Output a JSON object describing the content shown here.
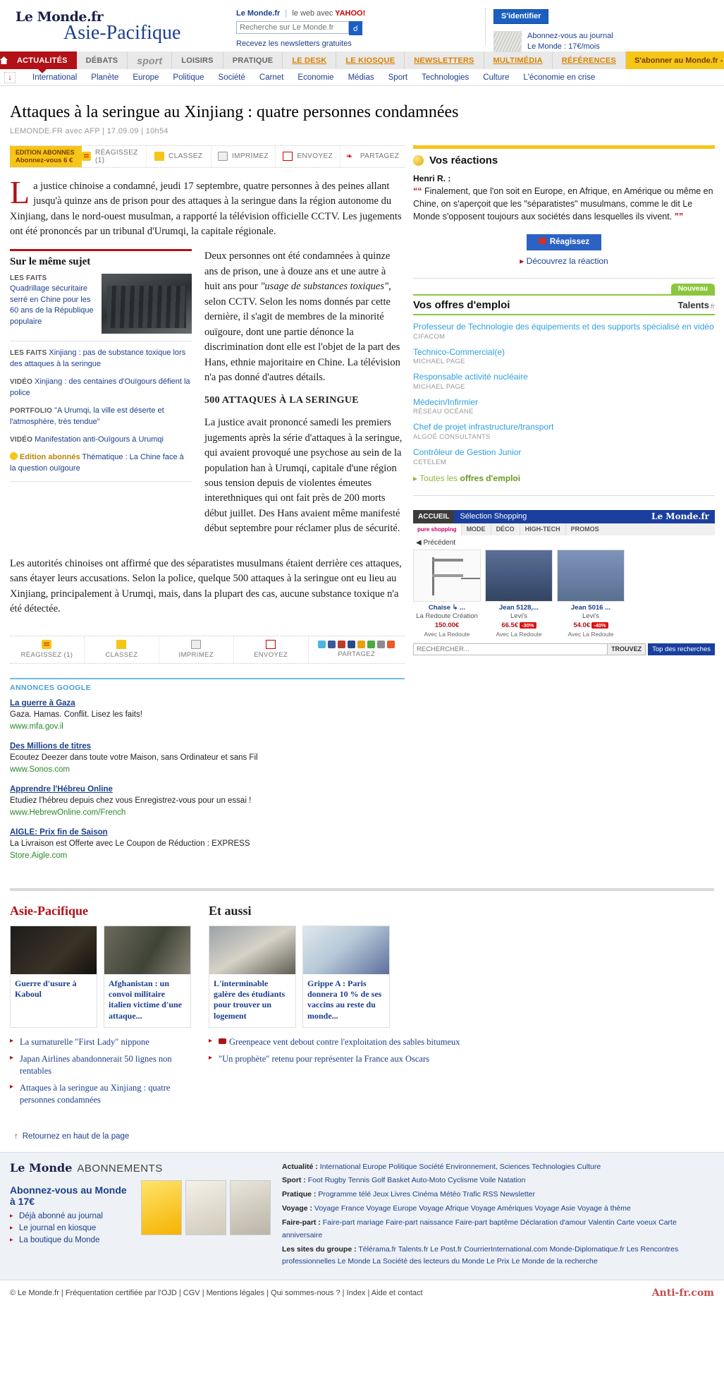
{
  "header": {
    "logo": "Le Monde.fr",
    "section_title": "Asie-Pacifique",
    "brand_label": "Le Monde.fr",
    "web_label": "le web avec",
    "yahoo": "YAHOO!",
    "search_placeholder": "Recherche sur Le Monde.fr",
    "search_icon": "search-icon",
    "newsletters": "Recevez les newsletters gratuites",
    "signin": "S'identifier",
    "subscribe_line1": "Abonnez-vous au journal",
    "subscribe_line2": "Le Monde : 17€/mois"
  },
  "mainnav": {
    "home_icon": "home-icon",
    "items": [
      {
        "label": "ACTUALITÉS",
        "style": "active"
      },
      {
        "label": "DÉBATS",
        "style": "grey"
      },
      {
        "label": "sport",
        "style": "sportlogo"
      },
      {
        "label": "LOISIRS",
        "style": "grey"
      },
      {
        "label": "PRATIQUE",
        "style": "grey"
      },
      {
        "label": "LE DESK",
        "style": "orange"
      },
      {
        "label": "LE KIOSQUE",
        "style": "orange"
      },
      {
        "label": "NEWSLETTERS",
        "style": "orange"
      },
      {
        "label": "MULTIMÉDIA",
        "style": "orange"
      },
      {
        "label": "RÉFÉRENCES",
        "style": "orange"
      }
    ],
    "promo": "S'abonner au Monde.fr - 6€ / mois"
  },
  "subnav": {
    "anchor_icon": "down-arrow-icon",
    "items": [
      "International",
      "Planète",
      "Europe",
      "Politique",
      "Société",
      "Carnet",
      "Economie",
      "Médias",
      "Sport",
      "Technologies",
      "Culture",
      "L'économie en crise"
    ]
  },
  "article": {
    "title": "Attaques à la seringue au Xinjiang : quatre personnes condamnées",
    "byline": "LEMONDE.FR avec AFP | 17.09.09 | 10h54",
    "dropcap": "L",
    "chapo": "a justice chinoise a condamné, jeudi 17 septembre, quatre personnes à des peines allant jusqu'à quinze ans de prison pour des attaques à la seringue dans la région autonome du Xinjiang, dans le nord-ouest musulman, a rapporté la télévision officielle CCTV. Les jugements ont été prononcés par un tribunal d'Urumqi, la capitale régionale.",
    "para2_a": "Deux personnes ont été condamnées à quinze ans de prison, une à douze ans et une autre à huit ans pour ",
    "para2_italic": "\"usage de substances toxiques\"",
    "para2_b": ", selon CCTV. Selon les noms donnés par cette dernière, il s'agit de membres de la minorité ouïgoure, dont une partie dénonce la discrimination dont elle est l'objet de la part des Hans, ethnie majoritaire en Chine. La télévision n'a pas donné d'autres détails.",
    "subtitle": "500 ATTAQUES À LA SERINGUE",
    "para3": "La justice avait prononcé samedi les premiers jugements après la série d'attaques à la seringue, qui avaient provoqué une psychose au sein de la population han à Urumqi, capitale d'une région sous tension depuis de violentes émeutes interethniques qui ont fait près de 200 morts début juillet. Des Hans avaient même manifesté début septembre pour réclamer plus de sécurité.",
    "para4": "Les autorités chinoises ont affirmé que des séparatistes musulmans étaient derrière ces attaques, sans étayer leurs accusations. Selon la police, quelque 500 attaques à la seringue ont eu lieu au Xinjiang, principalement à Urumqi, mais, dans la plupart des cas, aucune substance toxique n'a été détectée."
  },
  "toolbar": {
    "abo_line1": "EDITION ABONNES",
    "abo_line2": "Abonnez-vous 6 €",
    "items": [
      {
        "label": "RÉAGISSEZ (1)",
        "icon": "comment-icon"
      },
      {
        "label": "CLASSEZ",
        "icon": "bookmark-icon"
      },
      {
        "label": "IMPRIMEZ",
        "icon": "printer-icon"
      },
      {
        "label": "ENVOYEZ",
        "icon": "envelope-icon"
      },
      {
        "label": "PARTAGEZ",
        "icon": "share-icon"
      }
    ]
  },
  "sharebar": {
    "items": [
      {
        "label": "RÉAGISSEZ (1)",
        "icon": "comment-icon"
      },
      {
        "label": "CLASSEZ",
        "icon": "bookmark-icon"
      },
      {
        "label": "IMPRIMEZ",
        "icon": "printer-icon"
      },
      {
        "label": "ENVOYEZ",
        "icon": "envelope-icon"
      },
      {
        "label": "PARTAGEZ",
        "icon": "share-icon"
      }
    ],
    "share_icons": [
      "twitter-icon",
      "facebook-icon",
      "wikio-icon",
      "delicious-icon",
      "scoopeo-icon",
      "google-icon",
      "netvibes-icon",
      "more-icon"
    ]
  },
  "same_subject": {
    "heading": "Sur le même sujet",
    "featured": {
      "label": "LES FAITS",
      "link": "Quadrillage sécuritaire serré en Chine pour les 60 ans de la République populaire",
      "thumb": "riot-police-photo"
    },
    "items": [
      {
        "label": "LES FAITS",
        "link": "Xinjiang : pas de substance toxique lors des attaques à la seringue"
      },
      {
        "label": "VIDÉO",
        "link": "Xinjiang : des centaines d'Ouïgours défient la police"
      },
      {
        "label": "PORTFOLIO",
        "link": "\"A Urumqi, la ville est déserte et l'atmosphère, très tendue\""
      },
      {
        "label": "VIDÉO",
        "link": "Manifestation anti-Ouïgours à Urumqi"
      },
      {
        "label": "Edition abonnés",
        "link": "Thématique : La Chine face à la question ouïgoure",
        "badge": true
      }
    ]
  },
  "reactions": {
    "heading": "Vos réactions",
    "icon": "smiley-icon",
    "author": "Henri R. :",
    "quote": "Finalement, que l'on soit en Europe, en Afrique, en Amérique ou même en Chine, on s'aperçoit que les \"séparatistes\" musulmans, comme le dit Le Monde s'opposent toujours aux sociétés dans lesquelles ils vivent.",
    "button": "Réagissez",
    "discover": "Découvrez la réaction"
  },
  "jobs": {
    "badge": "Nouveau",
    "heading": "Vos offres d'emploi",
    "logo": "Talents",
    "logo_tld": ".fr",
    "items": [
      {
        "title": "Professeur de Technologie des équipements et des supports spécialisé en vidéo",
        "company": "CIFACOM"
      },
      {
        "title": "Technico-Commercial(e)",
        "company": "MICHAEL PAGE"
      },
      {
        "title": "Responsable activité nucléaire",
        "company": "MICHAEL PAGE"
      },
      {
        "title": "Médecin/Infirmier",
        "company": "RÉSEAU OCÉANE"
      },
      {
        "title": "Chef de projet infrastructure/transport",
        "company": "ALGOÉ CONSULTANTS"
      },
      {
        "title": "Contrôleur de Gestion Junior",
        "company": "CETELEM"
      }
    ],
    "all_prefix": "Toutes les ",
    "all_bold": "offres d'emploi"
  },
  "shopping": {
    "accueil": "ACCUEIL",
    "title": "Sélection Shopping",
    "brand": "Le Monde.fr",
    "pure_tag": "pure shopping",
    "tabs": [
      "MODE",
      "DÉCO",
      "HIGH-TECH",
      "PROMOS"
    ],
    "prev": "Précédent",
    "products": [
      {
        "name": "Chaise ↳ ...",
        "sub": "La Redoute Création",
        "price": "150.00€",
        "old": "",
        "promo": "",
        "retailer": "Avec La Redoute",
        "img": "chair"
      },
      {
        "name": "Jean 5128,...",
        "sub": "Levi's",
        "price": "66.5€",
        "old": "",
        "promo": "-30%",
        "retailer": "Avec La Redoute",
        "img": "jeans1"
      },
      {
        "name": "Jean 5016 ...",
        "sub": "Levi's",
        "price": "54.0€",
        "old": "",
        "promo": "-40%",
        "retailer": "Avec La Redoute",
        "img": "jeans2"
      }
    ],
    "search_placeholder": "RECHERCHER...",
    "search_button": "TROUVEZ",
    "top_searches": "Top des recherches"
  },
  "ads": {
    "heading": "ANNONCES GOOGLE",
    "items": [
      {
        "title": "La guerre à Gaza",
        "desc": "Gaza. Hamas. Conflit. Lisez les faits!",
        "url": "www.mfa.gov.il"
      },
      {
        "title": "Des Millions de titres",
        "desc": "Ecoutez Deezer dans toute votre Maison, sans Ordinateur et sans Fil",
        "url": "www.Sonos.com"
      },
      {
        "title": "Apprendre l'Hébreu Online",
        "desc": "Etudiez l'hébreu depuis chez vous Enregistrez-vous pour un essai !",
        "url": "www.HebrewOnline.com/French"
      },
      {
        "title": "AIGLE: Prix fin de Saison",
        "desc": "La Livraison est Offerte avec Le Coupon de Réduction : EXPRESS",
        "url": "Store.Aigle.com"
      }
    ]
  },
  "bottom": {
    "left_title": "Asie-Pacifique",
    "right_title": "Et aussi",
    "left_cards": [
      {
        "caption": "Guerre d'usure à Kaboul",
        "img": "karzai-photo"
      },
      {
        "caption": "Afghanistan : un convoi militaire italien victime d'une attaque...",
        "img": "convoy-photo"
      }
    ],
    "right_cards": [
      {
        "caption": "L'interminable galère des étudiants pour trouver un logement",
        "img": "students-photo"
      },
      {
        "caption": "Grippe A : Paris donnera 10 % de ses vaccins au reste du monde...",
        "img": "vaccine-photo"
      }
    ],
    "left_links": [
      {
        "text": "La surnaturelle \"First Lady\" nippone",
        "video": false
      },
      {
        "text": "Japan Airlines abandonnerait 50 lignes non rentables",
        "video": false
      },
      {
        "text": "Attaques à la seringue au Xinjiang : quatre personnes condamnées",
        "video": false
      }
    ],
    "right_links": [
      {
        "text": "Greenpeace vent debout contre l'exploitation des sables bitumeux",
        "video": true
      },
      {
        "text": "\"Un prophète\" retenu pour représenter la France aux Oscars",
        "video": false
      }
    ]
  },
  "return_top": "Retournez en haut de la page",
  "footer": {
    "brand": "Le Monde",
    "abonnements": "ABONNEMENTS",
    "headline": "Abonnez-vous au Monde à 17€",
    "links": [
      "Déjà abonné au journal",
      "Le journal en kiosque",
      "La boutique du Monde"
    ],
    "rows": [
      {
        "label": "Actualité :",
        "links": [
          "International",
          "Europe",
          "Politique",
          "Société",
          "Environnement, Sciences",
          "Technologies",
          "Culture"
        ]
      },
      {
        "label": "Sport :",
        "links": [
          "Foot",
          "Rugby",
          "Tennis",
          "Golf",
          "Basket",
          "Auto-Moto",
          "Cyclisme",
          "Voile",
          "Natation"
        ]
      },
      {
        "label": "Pratique :",
        "links": [
          "Programme télé",
          "Jeux",
          "Livres",
          "Cinéma",
          "Météo",
          "Trafic",
          "RSS",
          "Newsletter"
        ]
      },
      {
        "label": "Voyage :",
        "links": [
          "Voyage France",
          "Voyage Europe",
          "Voyage Afrique",
          "Voyage Amériques",
          "Voyage Asie",
          "Voyage à thème"
        ]
      },
      {
        "label": "Faire-part :",
        "links": [
          "Faire-part mariage",
          "Faire-part naissance",
          "Faire-part baptême",
          "Déclaration d'amour",
          "Valentin",
          "Carte voeux",
          "Carte anniversaire"
        ]
      },
      {
        "label": "Les sites du groupe :",
        "links": [
          "Télérama.fr",
          "Talents.fr",
          "Le Post.fr",
          "CourrierInternational.com",
          "Monde-Diplomatique.fr",
          "Les Rencontres professionnelles Le Monde",
          "La Société des lecteurs du Monde",
          "Le Prix Le Monde de la recherche"
        ]
      }
    ]
  },
  "legal": {
    "text": "© Le Monde.fr | Fréquentation certifiée par l'OJD | CGV | Mentions légales | Qui sommes-nous ? | Index | Aide et contact",
    "watermark": "Anti-fr.com"
  }
}
